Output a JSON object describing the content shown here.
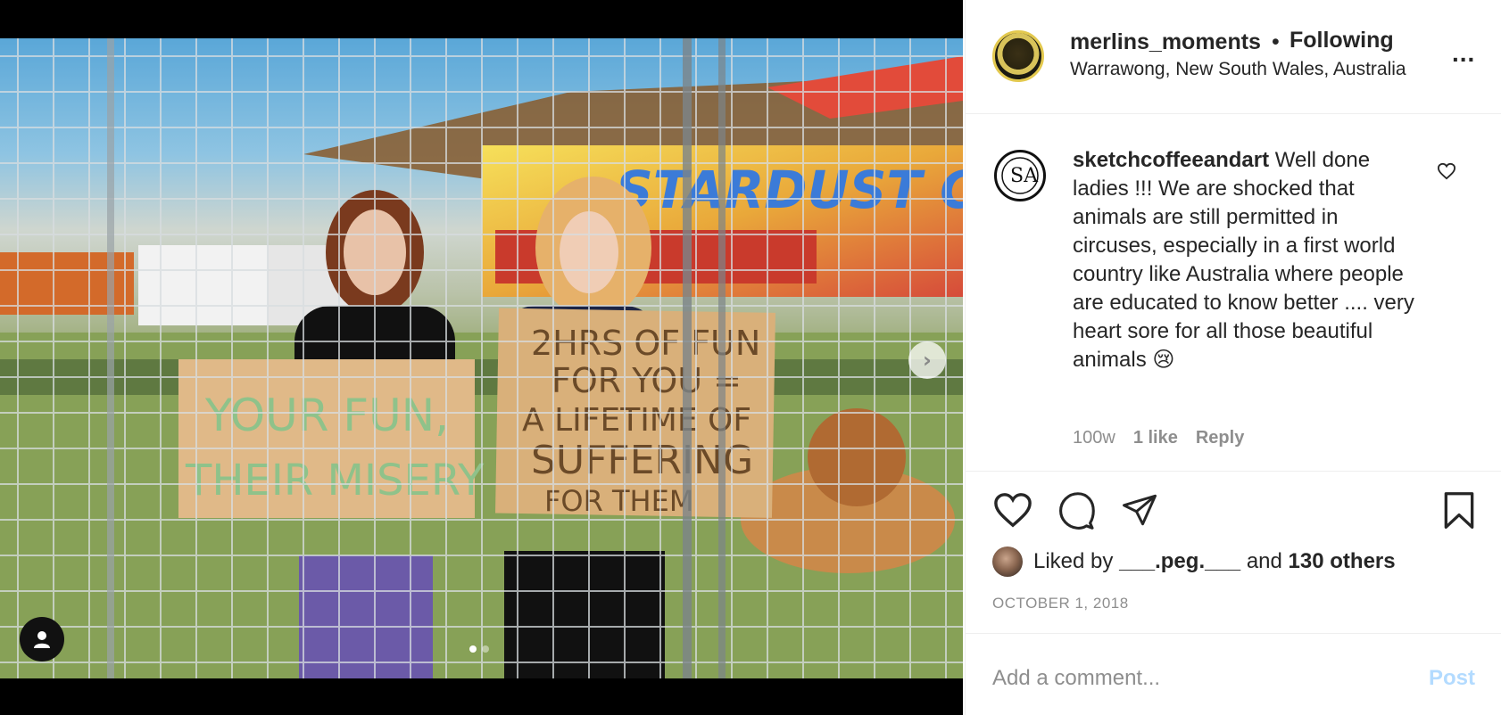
{
  "post": {
    "author": {
      "username": "merlins_moments",
      "separator": "•",
      "follow_status": "Following",
      "location": "Warrawong, New South Wales, Australia",
      "avatar_icon": "profile-avatar-icon"
    },
    "more_icon": "more-options-icon",
    "more_glyph": "...",
    "media": {
      "sign_left_line1": "YOUR FUN,",
      "sign_left_line2": "THEIR MISERY",
      "sign_right_line1": "2HRS OF FUN",
      "sign_right_line2": "FOR YOU =",
      "sign_right_line3": "A LIFETIME OF",
      "sign_right_line4": "SUFFERING",
      "sign_right_line5": "FOR THEM",
      "banner_text": "STARDUST CIRCUS",
      "carousel_total": 2,
      "carousel_active": 1,
      "next_glyph": "›"
    },
    "comment": {
      "username": "sketchcoffeeandart",
      "text": " Well done ladies !!! We are shocked that animals are still permitted in circuses, especially in a first world country like Australia where people are educated to know better .... very heart sore for all those beautiful animals 😢",
      "age": "100w",
      "likes": "1 like",
      "reply": "Reply"
    },
    "liked_by": {
      "prefix": "Liked by ",
      "user": "___.peg.___",
      "middle": " and ",
      "others": "130 others"
    },
    "date": "OCTOBER 1, 2018",
    "add_comment": {
      "placeholder": "Add a comment...",
      "post_label": "Post"
    },
    "colors": {
      "text": "#262626",
      "muted": "#8e8e8e",
      "post_disabled": "#b3dbff",
      "border": "#efefef"
    }
  }
}
